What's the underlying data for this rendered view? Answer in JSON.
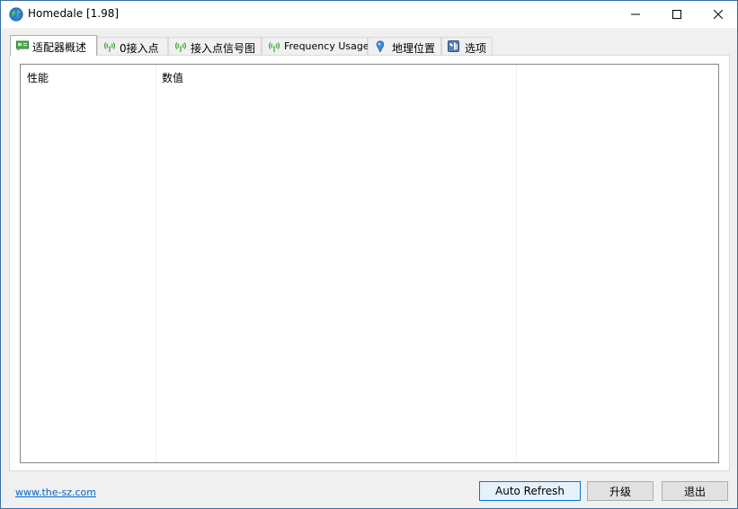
{
  "window": {
    "title": "Homedale [1.98]",
    "icon": "globe-icon",
    "controls": {
      "minimize_icon": "minimize-icon",
      "maximize_icon": "maximize-icon",
      "close_icon": "close-icon"
    }
  },
  "tabs": [
    {
      "label": "适配器概述",
      "icon": "network-card-icon",
      "active": true
    },
    {
      "label": "0接入点",
      "icon": "wifi-antenna-icon",
      "active": false
    },
    {
      "label": "接入点信号图",
      "icon": "wifi-antenna-icon",
      "active": false
    },
    {
      "label": "Frequency Usage",
      "icon": "wifi-antenna-icon",
      "active": false
    },
    {
      "label": "地理位置",
      "icon": "location-pin-icon",
      "active": false
    },
    {
      "label": "选项",
      "icon": "settings-icon",
      "active": false
    }
  ],
  "list": {
    "columns": [
      "性能",
      "数值",
      ""
    ],
    "rows": []
  },
  "footer": {
    "link": "www.the-sz.com",
    "auto_refresh": "Auto Refresh",
    "upgrade": "升级",
    "exit": "退出"
  },
  "colors": {
    "accent": "#0078d7",
    "wifi_green": "#3aa335",
    "link": "#0066cc",
    "pin_blue": "#3b8fd8"
  }
}
